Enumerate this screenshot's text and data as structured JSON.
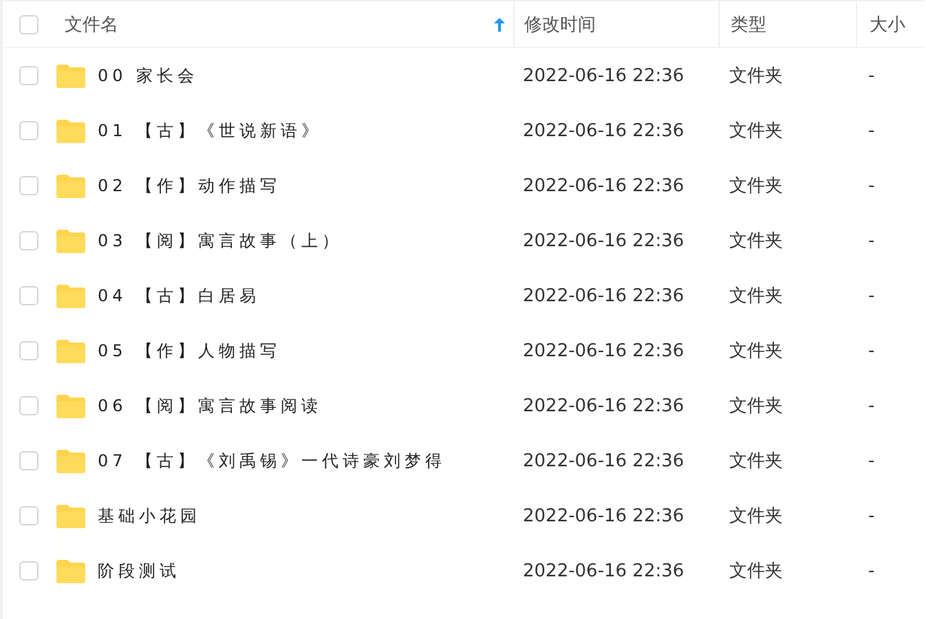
{
  "table": {
    "columns": [
      {
        "label": "文件名",
        "sorted": true
      },
      {
        "label": "修改时间",
        "sorted": false
      },
      {
        "label": "类型",
        "sorted": false
      },
      {
        "label": "大小",
        "sorted": false
      }
    ],
    "all_checked": false,
    "rows": [
      {
        "name": "00 家长会",
        "modified": "2022-06-16 22:36",
        "type": "文件夹",
        "size": "-",
        "checked": false
      },
      {
        "name": "01 【古】《世说新语》",
        "modified": "2022-06-16 22:36",
        "type": "文件夹",
        "size": "-",
        "checked": false
      },
      {
        "name": "02 【作】动作描写",
        "modified": "2022-06-16 22:36",
        "type": "文件夹",
        "size": "-",
        "checked": false
      },
      {
        "name": "03 【阅】寓言故事（上）",
        "modified": "2022-06-16 22:36",
        "type": "文件夹",
        "size": "-",
        "checked": false
      },
      {
        "name": "04 【古】白居易",
        "modified": "2022-06-16 22:36",
        "type": "文件夹",
        "size": "-",
        "checked": false
      },
      {
        "name": "05 【作】人物描写",
        "modified": "2022-06-16 22:36",
        "type": "文件夹",
        "size": "-",
        "checked": false
      },
      {
        "name": "06 【阅】寓言故事阅读",
        "modified": "2022-06-16 22:36",
        "type": "文件夹",
        "size": "-",
        "checked": false
      },
      {
        "name": "07 【古】《刘禹锡》一代诗豪刘梦得",
        "modified": "2022-06-16 22:36",
        "type": "文件夹",
        "size": "-",
        "checked": false
      },
      {
        "name": "基础小花园",
        "modified": "2022-06-16 22:36",
        "type": "文件夹",
        "size": "-",
        "checked": false
      },
      {
        "name": "阶段测试",
        "modified": "2022-06-16 22:36",
        "type": "文件夹",
        "size": "-",
        "checked": false
      }
    ]
  }
}
